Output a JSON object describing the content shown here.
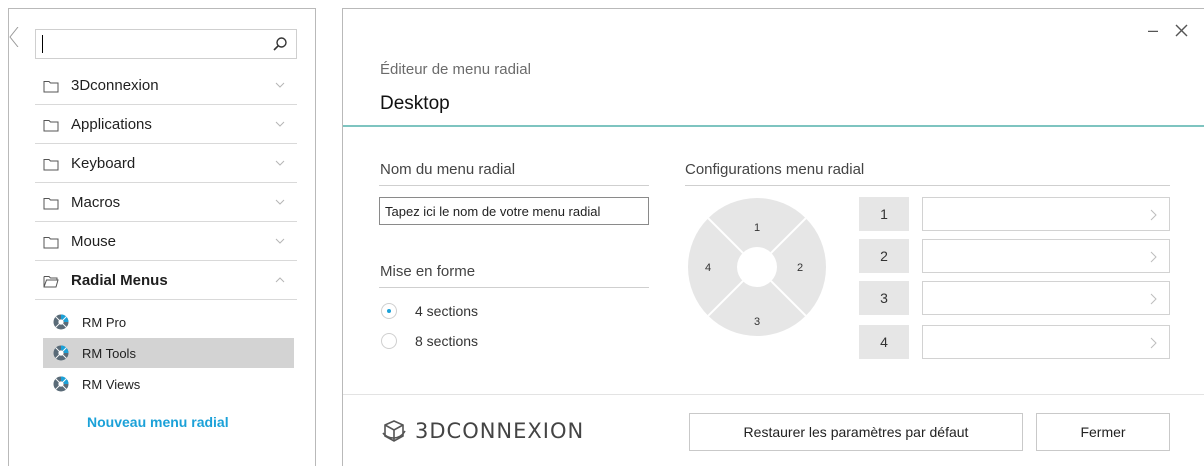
{
  "sidebar": {
    "search": {
      "value": "",
      "placeholder": ""
    },
    "tree": [
      {
        "label": "3Dconnexion",
        "expanded": false
      },
      {
        "label": "Applications",
        "expanded": false
      },
      {
        "label": "Keyboard",
        "expanded": false
      },
      {
        "label": "Macros",
        "expanded": false
      },
      {
        "label": "Mouse",
        "expanded": false
      },
      {
        "label": "Radial Menus",
        "expanded": true
      }
    ],
    "radial_menus": [
      {
        "label": "RM Pro",
        "selected": false
      },
      {
        "label": "RM Tools",
        "selected": true
      },
      {
        "label": "RM Views",
        "selected": false
      }
    ],
    "new_menu_label": "Nouveau menu radial"
  },
  "dialog": {
    "subtitle": "Éditeur de menu radial",
    "title": "Desktop",
    "name_section_label": "Nom du menu radial",
    "name_input_value": "Tapez ici le nom de votre menu radial",
    "layout_section_label": "Mise en forme",
    "layout_options": [
      {
        "label": "4 sections",
        "checked": true
      },
      {
        "label": "8 sections",
        "checked": false
      }
    ],
    "config_section_label": "Configurations menu radial",
    "radial_sections": [
      "1",
      "2",
      "3",
      "4"
    ],
    "slots": [
      {
        "number": "1",
        "value": ""
      },
      {
        "number": "2",
        "value": ""
      },
      {
        "number": "3",
        "value": ""
      },
      {
        "number": "4",
        "value": ""
      }
    ],
    "brand": "3DCONNEXION",
    "restore_button": "Restaurer les paramètres par défaut",
    "close_button": "Fermer"
  },
  "colors": {
    "accent": "#1ba1d8",
    "teal_rule": "#7ec4c0",
    "selection": "#d3d3d3",
    "radial_fill": "#e6e6e6"
  }
}
